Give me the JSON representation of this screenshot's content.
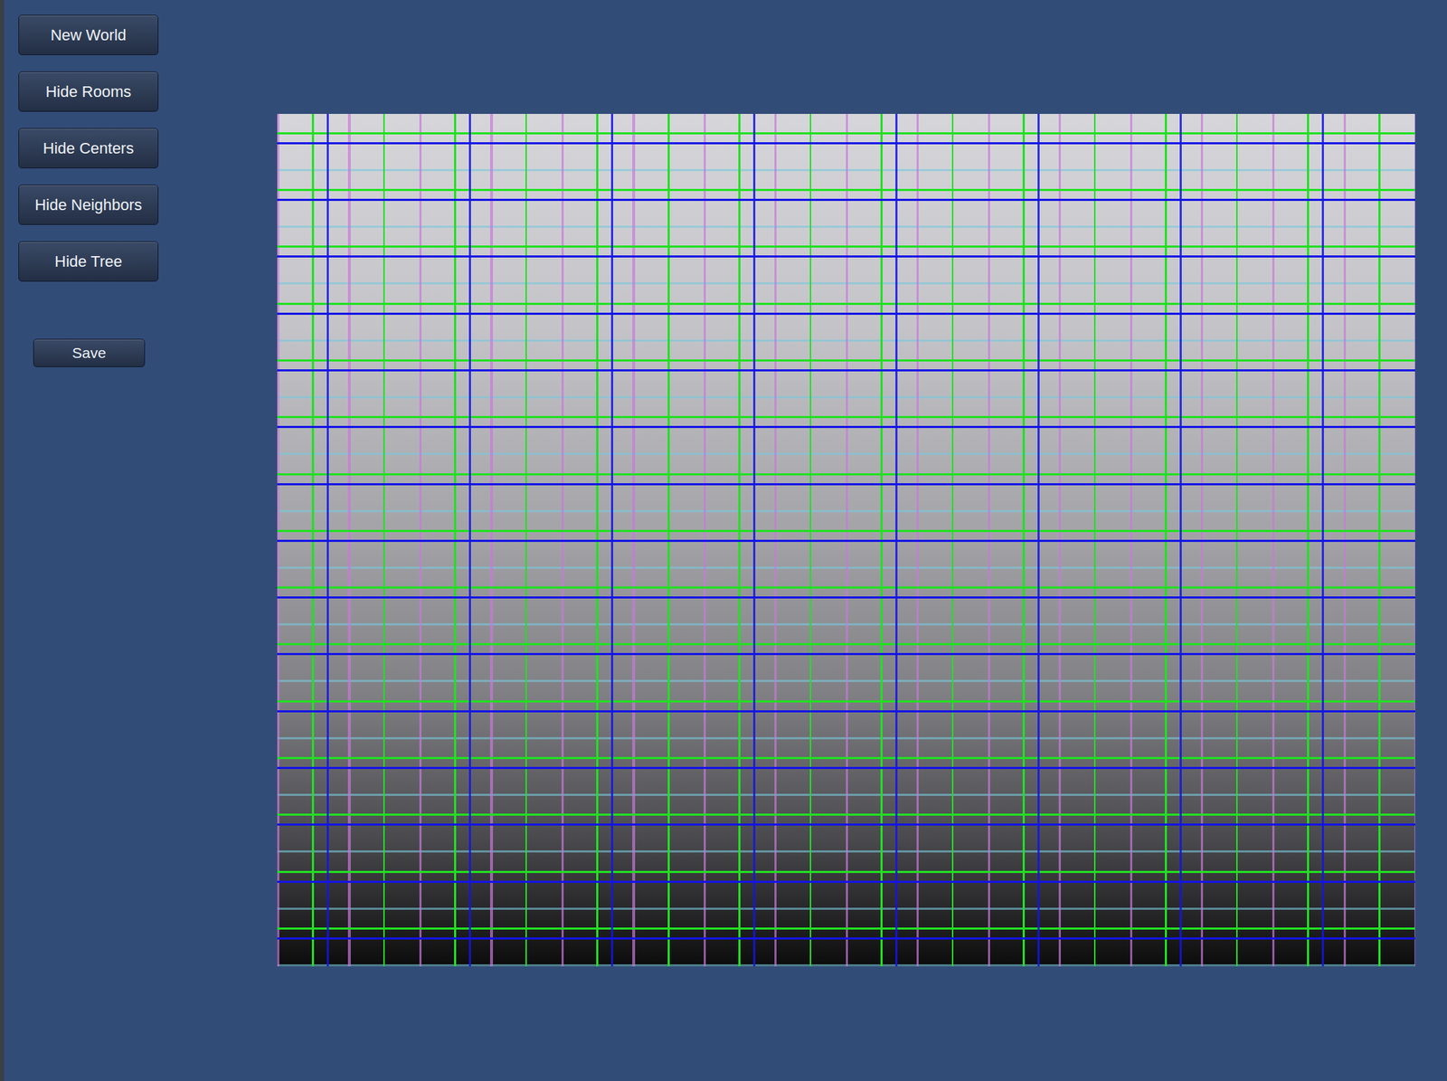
{
  "toolbar": {
    "buttons": [
      {
        "label": "New World"
      },
      {
        "label": "Hide Rooms"
      },
      {
        "label": "Hide Centers"
      },
      {
        "label": "Hide Neighbors"
      },
      {
        "label": "Hide Tree"
      }
    ]
  },
  "save_button": {
    "label": "Save"
  }
}
